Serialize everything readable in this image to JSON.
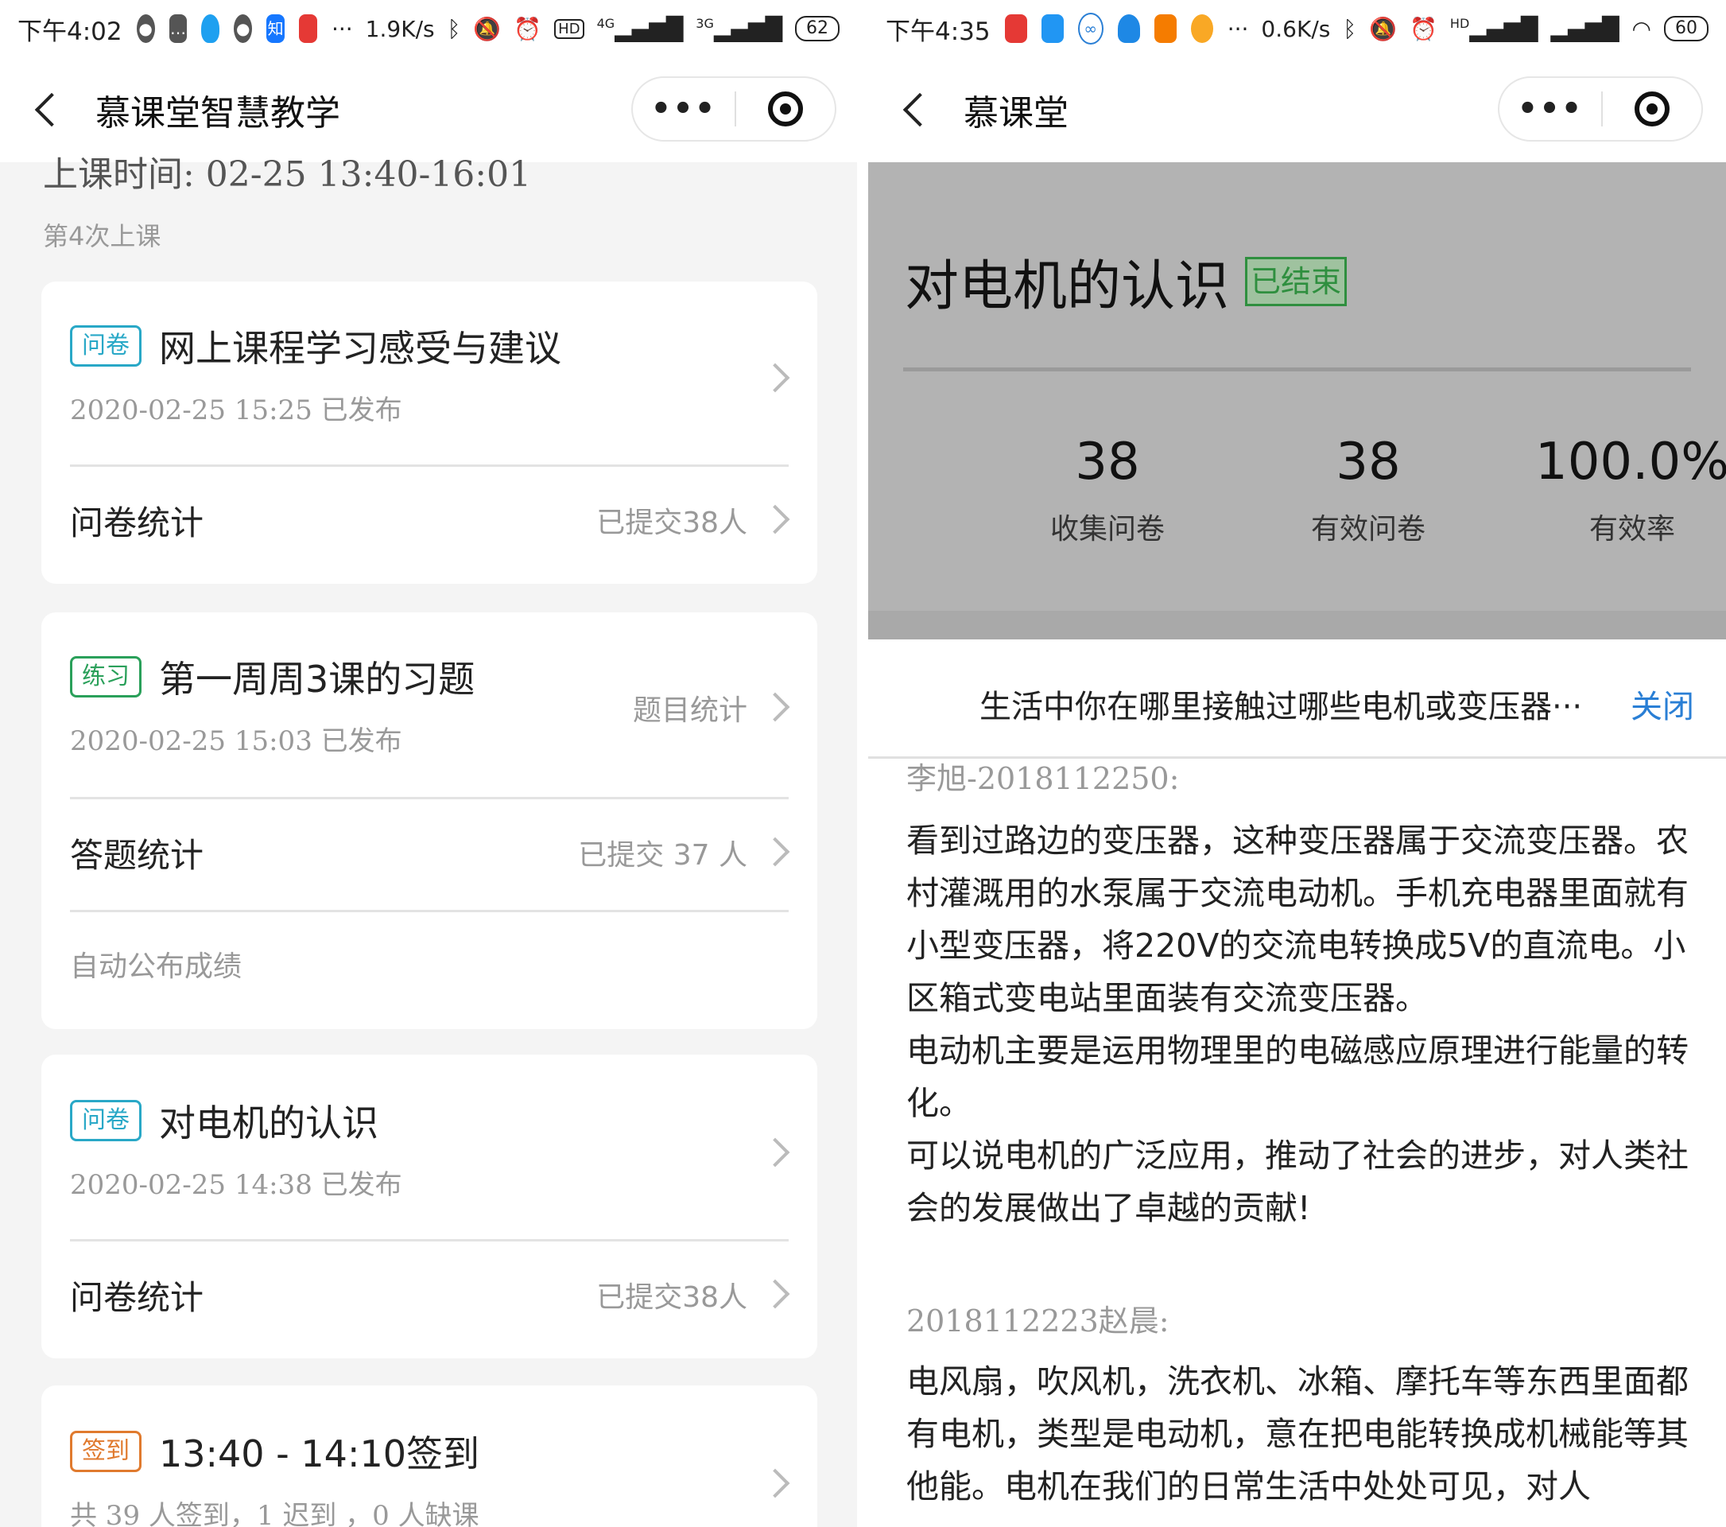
{
  "left": {
    "status": {
      "time": "下午4:02",
      "speed": "1.9K/s",
      "net1": "4G",
      "net2": "3G",
      "battery": "62",
      "app_icons": [
        "wechat-icon",
        "message-icon",
        "qq-icon",
        "wechat-icon",
        "zhihu-icon",
        "red-app-icon"
      ],
      "zhihu_char": "知"
    },
    "nav": {
      "title": "慕课堂智慧教学",
      "more": "•••"
    },
    "class_time": "上课时间: 02-25 13:40-16:01",
    "session": "第4次上课",
    "cards": [
      {
        "tag": "问卷",
        "title": "网上课程学习感受与建议",
        "meta": "2020-02-25 15:25 已发布",
        "row_label": "问卷统计",
        "row_value": "已提交38人"
      },
      {
        "tag": "练习",
        "title": "第一周周3课的习题",
        "meta": "2020-02-25 15:03 已发布",
        "side_link": "题目统计",
        "row_label": "答题统计",
        "row_value": "已提交 37 人",
        "auto": "自动公布成绩"
      },
      {
        "tag": "问卷",
        "title": "对电机的认识",
        "meta": "2020-02-25 14:38 已发布",
        "row_label": "问卷统计",
        "row_value": "已提交38人"
      },
      {
        "tag": "签到",
        "title": "13:40 - 14:10签到",
        "meta": "共 39 人签到，1 迟到 ，0 人缺课"
      }
    ]
  },
  "right": {
    "status": {
      "time": "下午4:35",
      "speed": "0.6K/s",
      "net": "HD",
      "battery": "60"
    },
    "nav": {
      "title": "慕课堂",
      "more": "•••"
    },
    "survey": {
      "title": "对电机的认识",
      "status": "已结束",
      "stats": [
        {
          "value": "38",
          "label": "收集问卷"
        },
        {
          "value": "38",
          "label": "有效问卷"
        },
        {
          "value": "100.0%",
          "label": "有效率"
        }
      ]
    },
    "question": {
      "text": "生活中你在哪里接触过哪些电机或变压器···",
      "close": "关闭"
    },
    "answers": [
      {
        "name": "李旭-2018112250:",
        "paragraphs": [
          "看到过路边的变压器，这种变压器属于交流变压器。农村灌溉用的水泵属于交流电动机。手机充电器里面就有小型变压器，将220V的交流电转换成5V的直流电。小区箱式变电站里面装有交流变压器。",
          "电动机主要是运用物理里的电磁感应原理进行能量的转化。",
          "可以说电机的广泛应用，推动了社会的进步，对人类社会的发展做出了卓越的贡献!"
        ]
      },
      {
        "name": "2018112223赵晨:",
        "paragraphs": [
          "电风扇，吹风机，洗衣机、冰箱、摩托车等东西里面都有电机，类型是电动机，意在把电能转换成机械能等其他能。电机在我们的日常生活中处处可见，对人"
        ]
      }
    ]
  }
}
